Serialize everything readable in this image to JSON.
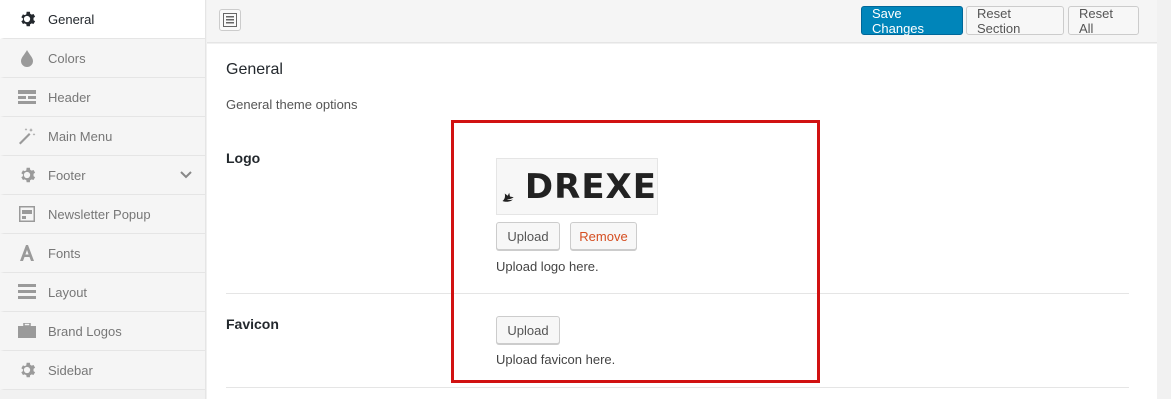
{
  "sidebar": {
    "items": [
      {
        "label": "General",
        "icon": "gear-icon",
        "active": true
      },
      {
        "label": "Colors",
        "icon": "droplet-icon"
      },
      {
        "label": "Header",
        "icon": "header-icon"
      },
      {
        "label": "Main Menu",
        "icon": "magic-wand-icon"
      },
      {
        "label": "Footer",
        "icon": "gear-icon",
        "expandable": true
      },
      {
        "label": "Newsletter Popup",
        "icon": "popup-icon"
      },
      {
        "label": "Fonts",
        "icon": "font-icon"
      },
      {
        "label": "Layout",
        "icon": "layout-icon"
      },
      {
        "label": "Brand Logos",
        "icon": "briefcase-icon"
      },
      {
        "label": "Sidebar",
        "icon": "gear-icon"
      }
    ]
  },
  "toolbar": {
    "save_label": "Save Changes",
    "reset_section_label": "Reset Section",
    "reset_all_label": "Reset All"
  },
  "section": {
    "title": "General",
    "description": "General theme options"
  },
  "fields": {
    "logo": {
      "label": "Logo",
      "preview_text": "DREXE",
      "upload_label": "Upload",
      "remove_label": "Remove",
      "help": "Upload logo here."
    },
    "favicon": {
      "label": "Favicon",
      "upload_label": "Upload",
      "help": "Upload favicon here."
    }
  },
  "colors": {
    "primary": "#0085ba",
    "highlight": "#d11111",
    "remove": "#d54e21"
  }
}
